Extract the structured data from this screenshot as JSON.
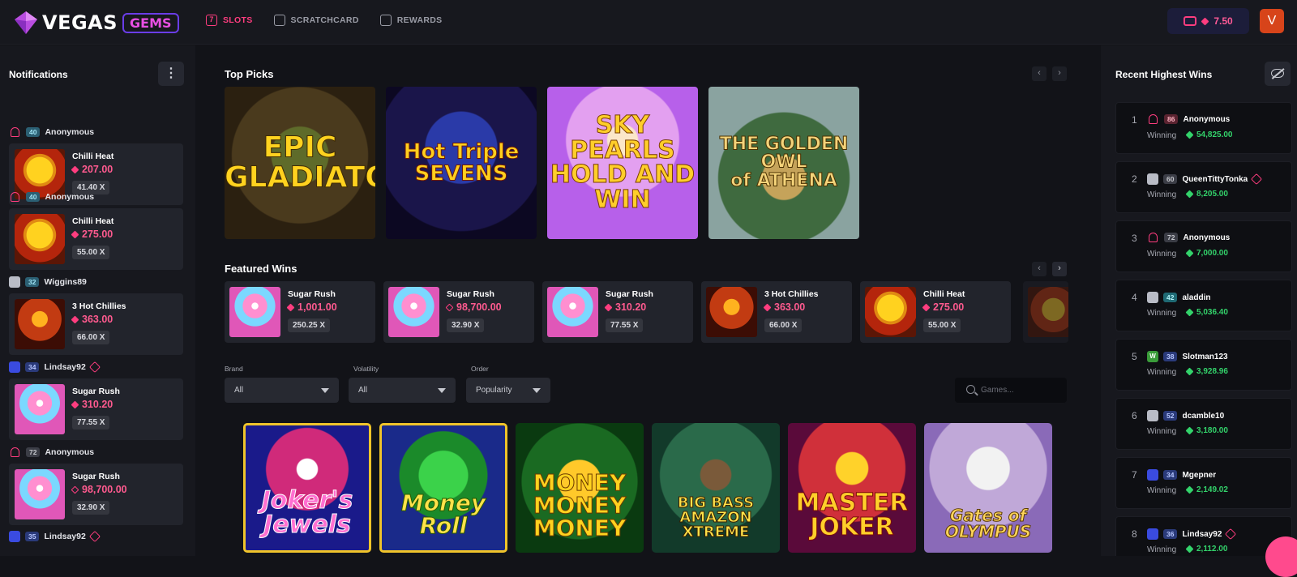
{
  "brand": {
    "name": "VEGAS",
    "badge": "GEMS"
  },
  "nav": [
    {
      "label": "SLOTS",
      "icon": "slot-icon",
      "glyph": "7",
      "active": true
    },
    {
      "label": "SCRATCHCARD",
      "icon": "scratchcard-icon",
      "glyph": "",
      "active": false
    },
    {
      "label": "REWARDS",
      "icon": "gift-icon",
      "glyph": "",
      "active": false
    }
  ],
  "account": {
    "balance": "7.50",
    "avatar_letter": "V"
  },
  "notifications": {
    "title": "Notifications",
    "items": [
      {
        "user": "Anonymous",
        "level": "40",
        "icon": "bell",
        "game": "Chilli Heat",
        "amount": "207.00",
        "multiplier": "41.40 X"
      },
      {
        "user": "Anonymous",
        "level": "40",
        "icon": "bell",
        "game": "Chilli Heat",
        "amount": "275.00",
        "multiplier": "55.00 X"
      },
      {
        "user": "Wiggins89",
        "level": "32",
        "icon": "pic",
        "game": "3 Hot Chillies",
        "amount": "363.00",
        "multiplier": "66.00 X"
      },
      {
        "user": "Lindsay92",
        "level": "34",
        "icon": "pixel",
        "game": "Sugar Rush",
        "amount": "310.20",
        "multiplier": "77.55 X"
      },
      {
        "user": "Anonymous",
        "level": "72",
        "icon": "bell",
        "game": "Sugar Rush",
        "amount": "98,700.00",
        "multiplier": "32.90 X"
      },
      {
        "user": "Lindsay92",
        "level": "35",
        "icon": "pixel",
        "game": "",
        "amount": "",
        "multiplier": ""
      }
    ]
  },
  "top_picks": {
    "title": "Top Picks",
    "games": [
      {
        "title": "EPIC\nGLADIATORS"
      },
      {
        "title": "Hot Triple\nSEVENS"
      },
      {
        "title": "SKY\nPEARLS\nHOLD AND WIN"
      },
      {
        "title": "THE GOLDEN OWL\nof ATHENA"
      }
    ]
  },
  "featured_wins": {
    "title": "Featured Wins",
    "items": [
      {
        "game": "Sugar Rush",
        "amount": "1,001.00",
        "multiplier": "250.25 X"
      },
      {
        "game": "Sugar Rush",
        "amount": "98,700.00",
        "multiplier": "32.90 X"
      },
      {
        "game": "Sugar Rush",
        "amount": "310.20",
        "multiplier": "77.55 X"
      },
      {
        "game": "3 Hot Chillies",
        "amount": "363.00",
        "multiplier": "66.00 X"
      },
      {
        "game": "Chilli Heat",
        "amount": "275.00",
        "multiplier": "55.00 X"
      }
    ]
  },
  "filters": {
    "brand": {
      "label": "Brand",
      "value": "All"
    },
    "volatility": {
      "label": "Volatility",
      "value": "All"
    },
    "order": {
      "label": "Order",
      "value": "Popularity"
    },
    "search_placeholder": "Games..."
  },
  "games": [
    {
      "title": "Joker's\nJewels"
    },
    {
      "title": "Money\nRoll"
    },
    {
      "title": "MONEY\nMONEY\nMONEY"
    },
    {
      "title": "BIG BASS\nAMAZON\nXTREME"
    },
    {
      "title": "MASTER\nJOKER"
    },
    {
      "title": "Gates of\nOLYMPUS"
    }
  ],
  "recent_wins": {
    "title": "Recent Highest Wins",
    "winning_label": "Winning",
    "items": [
      {
        "rank": "1",
        "level": "86",
        "user": "Anonymous",
        "amount": "54,825.00",
        "icon": "bell",
        "gem": false
      },
      {
        "rank": "2",
        "level": "60",
        "user": "QueenTittyTonka",
        "amount": "8,205.00",
        "icon": "pic",
        "gem": true
      },
      {
        "rank": "3",
        "level": "72",
        "user": "Anonymous",
        "amount": "7,000.00",
        "icon": "bell",
        "gem": false
      },
      {
        "rank": "4",
        "level": "42",
        "user": "aladdin",
        "amount": "5,036.40",
        "icon": "pic",
        "gem": false
      },
      {
        "rank": "5",
        "level": "38",
        "user": "Slotman123",
        "amount": "3,928.96",
        "icon": "w",
        "gem": false
      },
      {
        "rank": "6",
        "level": "52",
        "user": "dcamble10",
        "amount": "3,180.00",
        "icon": "pic",
        "gem": false
      },
      {
        "rank": "7",
        "level": "34",
        "user": "Mgepner",
        "amount": "2,149.02",
        "icon": "pixel",
        "gem": false
      },
      {
        "rank": "8",
        "level": "36",
        "user": "Lindsay92",
        "amount": "2,112.00",
        "icon": "pixel",
        "gem": true
      }
    ]
  },
  "colors": {
    "accent": "#ff3d7f",
    "win_green": "#33d36b",
    "bg": "#121318",
    "panel": "#17181e"
  }
}
